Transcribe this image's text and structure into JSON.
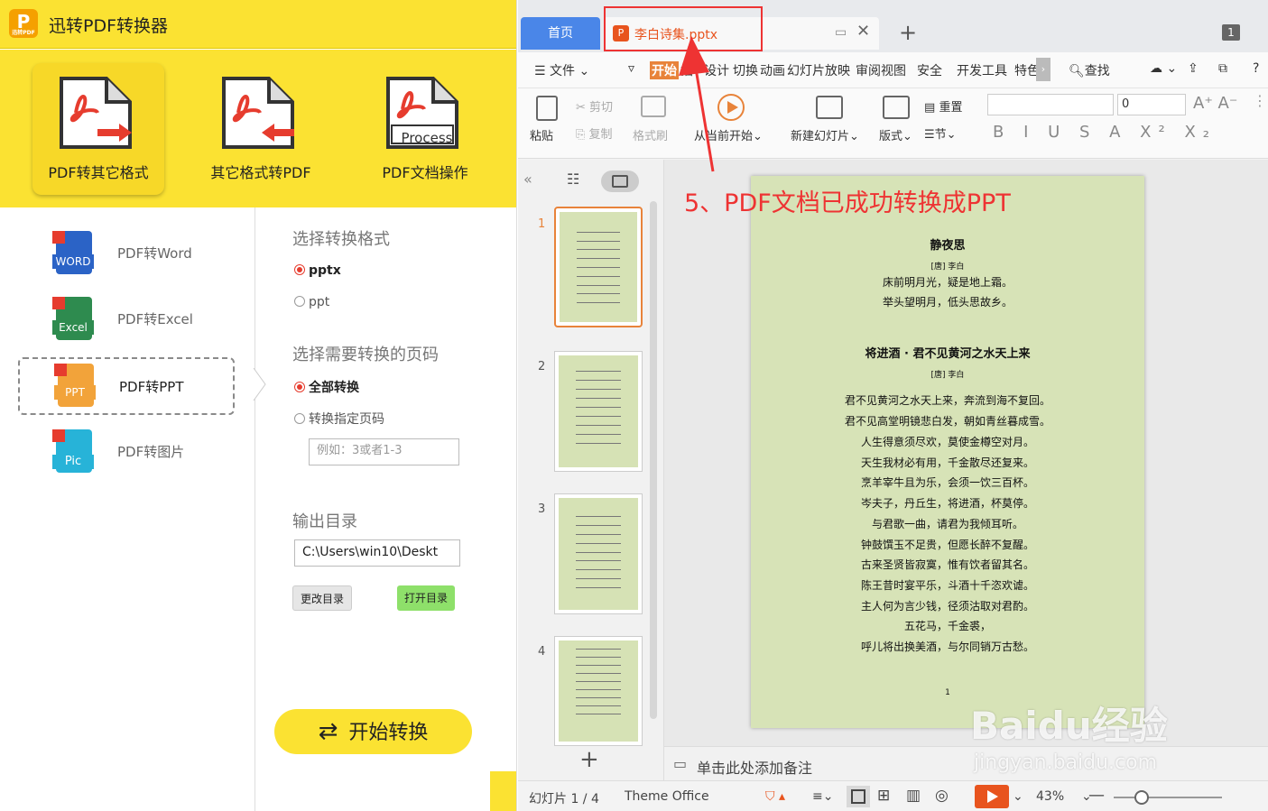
{
  "converter": {
    "title": "迅转PDF转换器",
    "logo_letter": "P",
    "logo_caption": "迅转PDF",
    "top_buttons": [
      {
        "label": "PDF转其它格式",
        "icon": "pdf-export-icon"
      },
      {
        "label": "其它格式转PDF",
        "icon": "pdf-import-icon"
      },
      {
        "label": "PDF文档操作",
        "icon": "pdf-process-icon",
        "badge": "Process"
      }
    ],
    "side_items": [
      {
        "label": "PDF转Word",
        "badge": "WORD",
        "color": "#2b63c6"
      },
      {
        "label": "PDF转Excel",
        "badge": "Excel",
        "color": "#2e8b4f"
      },
      {
        "label": "PDF转PPT",
        "badge": "PPT",
        "color": "#f2a33a"
      },
      {
        "label": "PDF转图片",
        "badge": "Pic",
        "color": "#27b3d8"
      }
    ],
    "format_heading": "选择转换格式",
    "formats": [
      "pptx",
      "ppt"
    ],
    "pages_heading": "选择需要转换的页码",
    "page_options": [
      "全部转换",
      "转换指定页码"
    ],
    "page_placeholder": "例如：3或者1-3",
    "output_heading": "输出目录",
    "output_path": "C:\\Users\\win10\\Deskt",
    "change_dir": "更改目录",
    "open_dir": "打开目录",
    "start": "开始转换"
  },
  "wps": {
    "home_tab": "首页",
    "file_tab": "李白诗集.pptx",
    "file_tab_icon": "P",
    "win_count": "1",
    "menu": {
      "file": "文件",
      "items": [
        "开始",
        "插",
        "设计",
        "切换",
        "动画",
        "幻灯片放映",
        "审阅",
        "视图",
        "安全",
        "开发工具",
        "特色"
      ],
      "search": "查找"
    },
    "ribbon": {
      "paste": "粘贴",
      "cut": "剪切",
      "copy": "复制",
      "format_painter": "格式刷",
      "from_current": "从当前开始",
      "new_slide": "新建幻灯片",
      "layout": "版式",
      "section": "节",
      "reset": "重置",
      "font_size": "0"
    },
    "thumb_numbers": [
      "1",
      "2",
      "3",
      "4"
    ],
    "annotation": "5、PDF文档已成功转换成PPT",
    "slide": {
      "title1": "静夜思",
      "author1": "[唐] 李白",
      "poem1": [
        "床前明月光，疑是地上霜。",
        "举头望明月，低头思故乡。"
      ],
      "title2": "将进酒 · 君不见黄河之水天上来",
      "author2": "[唐] 李白",
      "poem2": [
        "君不见黄河之水天上来，奔流到海不复回。",
        "君不见高堂明镜悲白发，朝如青丝暮成雪。",
        "人生得意须尽欢，莫使金樽空对月。",
        "天生我材必有用，千金散尽还复来。",
        "烹羊宰牛且为乐，会须一饮三百杯。",
        "岑夫子，丹丘生，将进酒，杯莫停。",
        "与君歌一曲，请君为我倾耳听。",
        "钟鼓馔玉不足贵，但愿长醉不复醒。",
        "古来圣贤皆寂寞，惟有饮者留其名。",
        "陈王昔时宴平乐，斗酒十千恣欢谑。",
        "主人何为言少钱，径须沽取对君酌。",
        "五花马，千金裘，",
        "呼儿将出换美酒，与尔同销万古愁。"
      ],
      "page_no": "1"
    },
    "notes": "单击此处添加备注",
    "status": {
      "slide_count": "幻灯片 1 / 4",
      "theme": "Theme Office",
      "zoom": "43%"
    }
  },
  "watermark": {
    "text": "Baidu经验",
    "url": "jingyan.baidu.com"
  }
}
